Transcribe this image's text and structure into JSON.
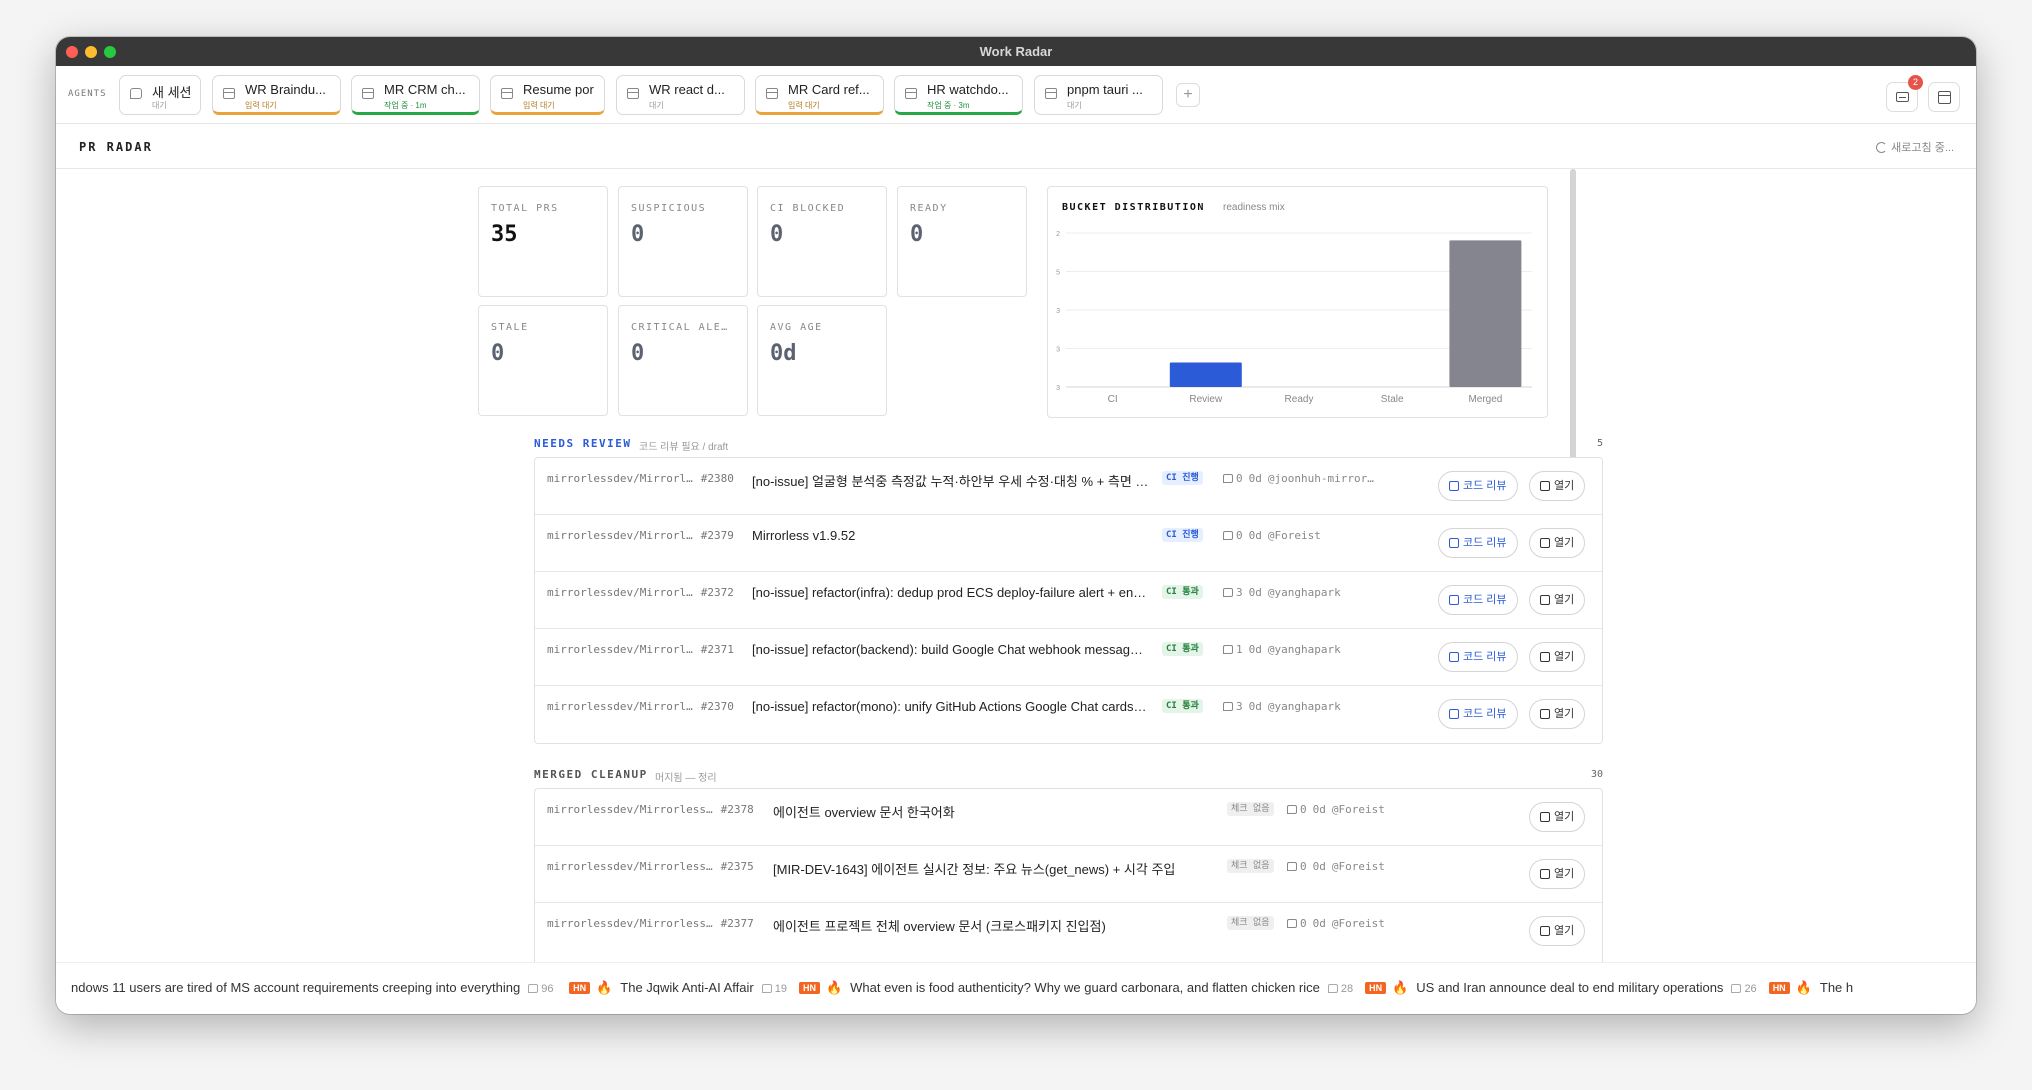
{
  "window": {
    "title": "Work Radar"
  },
  "agents": {
    "label": "AGENTS",
    "tabs": [
      {
        "name": "새 세션",
        "status": "대기",
        "state": "idle",
        "icon": "chat-icon"
      },
      {
        "name": "WR Braindu...",
        "status": "입력 대기",
        "state": "orange",
        "icon": "window-icon"
      },
      {
        "name": "MR CRM ch...",
        "status": "작업 중 · 1m",
        "state": "green",
        "icon": "window-icon"
      },
      {
        "name": "Resume por",
        "status": "입력 대기",
        "state": "orange",
        "icon": "window-icon"
      },
      {
        "name": "WR react d...",
        "status": "대기",
        "state": "idle",
        "icon": "window-icon"
      },
      {
        "name": "MR Card ref...",
        "status": "입력 대기",
        "state": "orange",
        "icon": "window-icon"
      },
      {
        "name": "HR watchdo...",
        "status": "작업 중 · 3m",
        "state": "green",
        "icon": "window-icon"
      },
      {
        "name": "pnpm tauri ...",
        "status": "대기",
        "state": "idle",
        "icon": "window-icon"
      }
    ],
    "add_label": "+",
    "inbox_badge": "2"
  },
  "page": {
    "title": "PR RADAR",
    "refresh_label": "새로고침 중..."
  },
  "stats": [
    {
      "label": "TOTAL PRS",
      "value": "35"
    },
    {
      "label": "SUSPICIOUS",
      "value": "0"
    },
    {
      "label": "CI BLOCKED",
      "value": "0"
    },
    {
      "label": "READY",
      "value": "0"
    },
    {
      "label": "STALE",
      "value": "0"
    },
    {
      "label": "CRITICAL ALE…",
      "value": "0"
    },
    {
      "label": "AVG AGE",
      "value": "0d"
    }
  ],
  "chart": {
    "title": "BUCKET DISTRIBUTION",
    "subtitle": "readiness mix"
  },
  "chart_data": {
    "type": "bar",
    "categories": [
      "CI",
      "Review",
      "Ready",
      "Stale",
      "Merged"
    ],
    "values": [
      0,
      5,
      0,
      0,
      30
    ],
    "yticks": [
      "2",
      "5",
      "3",
      "3",
      "3"
    ],
    "colors": [
      "#2b5bd7",
      "#2b5bd7",
      "#2b5bd7",
      "#2b5bd7",
      "#85858f"
    ],
    "ylim": [
      0,
      31.5
    ],
    "grid": true
  },
  "needs_review": {
    "title": "NEEDS REVIEW",
    "subtitle": "코드 리뷰 필요 / draft",
    "count": "5",
    "review_label": "코드 리뷰",
    "open_label": "열기",
    "rows": [
      {
        "repo": "mirrorlessdev/Mirrorl…",
        "number": "#2380",
        "title": "[no-issue] 얼굴형 분석중 측정값 누적·하안부 우세 수정·대칭 % + 측면 배…",
        "ci": "CI 진행",
        "ci_state": "run",
        "comments": "0",
        "age": "0d",
        "author": "@joonhuh-mirror…"
      },
      {
        "repo": "mirrorlessdev/Mirrorl…",
        "number": "#2379",
        "title": "Mirrorless v1.9.52",
        "ci": "CI 진행",
        "ci_state": "run",
        "comments": "0",
        "age": "0d",
        "author": "@Foreist"
      },
      {
        "repo": "mirrorlessdev/Mirrorl…",
        "number": "#2372",
        "title": "[no-issue] refactor(infra): dedup prod ECS deploy-failure alert + en…",
        "ci": "CI 통과",
        "ci_state": "pass",
        "comments": "3",
        "age": "0d",
        "author": "@yanghapark"
      },
      {
        "repo": "mirrorlessdev/Mirrorl…",
        "number": "#2371",
        "title": "[no-issue] refactor(backend): build Google Chat webhook messag…",
        "ci": "CI 통과",
        "ci_state": "pass",
        "comments": "1",
        "age": "0d",
        "author": "@yanghapark"
      },
      {
        "repo": "mirrorlessdev/Mirrorl…",
        "number": "#2370",
        "title": "[no-issue] refactor(mono): unify GitHub Actions Google Chat cards…",
        "ci": "CI 통과",
        "ci_state": "pass",
        "comments": "3",
        "age": "0d",
        "author": "@yanghapark"
      }
    ]
  },
  "merged_cleanup": {
    "title": "MERGED CLEANUP",
    "subtitle": "머지됨 — 정리",
    "count": "30",
    "open_label": "열기",
    "rows": [
      {
        "repo": "mirrorlessdev/Mirrorless…",
        "number": "#2378",
        "title": "에이전트 overview 문서 한국어화",
        "ci": "체크 없음",
        "comments": "0",
        "age": "0d",
        "author": "@Foreist"
      },
      {
        "repo": "mirrorlessdev/Mirrorless…",
        "number": "#2375",
        "title": "[MIR-DEV-1643] 에이전트 실시간 정보: 주요 뉴스(get_news) + 시각 주입",
        "ci": "체크 없음",
        "comments": "0",
        "age": "0d",
        "author": "@Foreist"
      },
      {
        "repo": "mirrorlessdev/Mirrorless…",
        "number": "#2377",
        "title": "에이전트 프로젝트 전체 overview 문서 (크로스패키지 진입점)",
        "ci": "체크 없음",
        "comments": "0",
        "age": "0d",
        "author": "@Foreist"
      }
    ]
  },
  "ticker": {
    "lead": "ndows 11 users are tired of MS account requirements creeping into everything",
    "lead_comments": "96",
    "items": [
      {
        "source": "HN",
        "title": "The Jqwik Anti-AI Affair",
        "comments": "19"
      },
      {
        "source": "HN",
        "title": "What even is food authenticity? Why we guard carbonara, and flatten chicken rice",
        "comments": "28"
      },
      {
        "source": "HN",
        "title": "US and Iran announce deal to end military operations",
        "comments": "26"
      },
      {
        "source": "HN",
        "title": "The h",
        "comments": ""
      }
    ]
  }
}
